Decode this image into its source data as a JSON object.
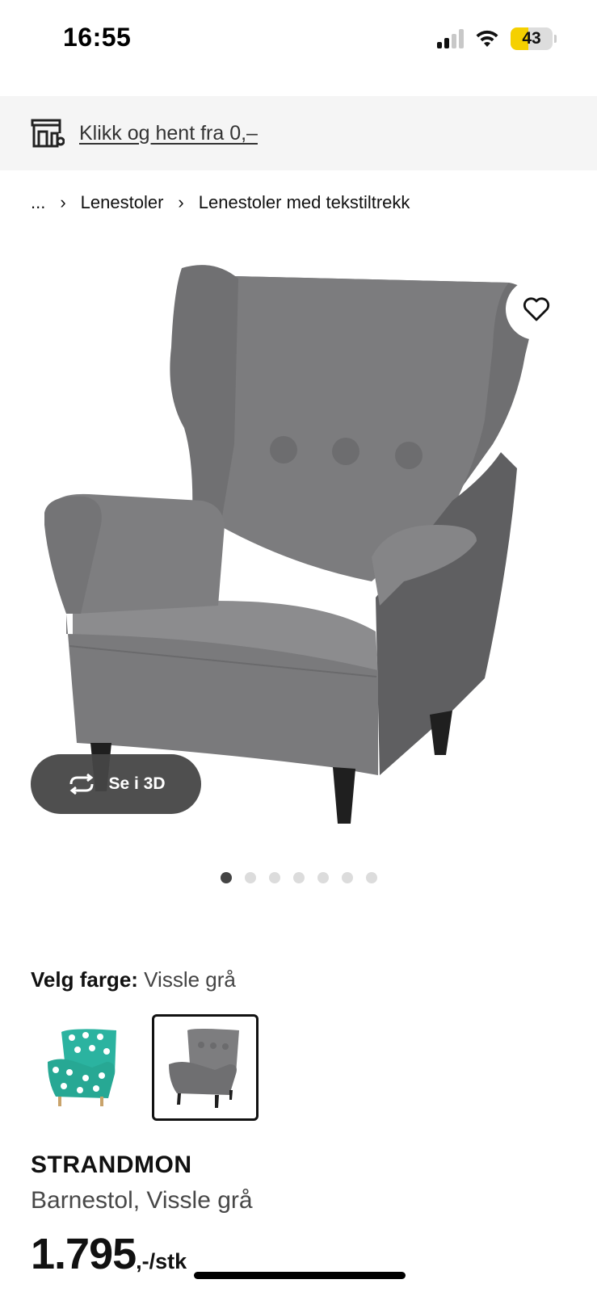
{
  "status_bar": {
    "time": "16:55",
    "battery_level": "43",
    "battery_fraction": 0.43
  },
  "banner": {
    "text": "Klikk og hent fra 0,–",
    "icon": "store-pickup-icon"
  },
  "breadcrumb": {
    "ellipsis": "...",
    "items": [
      "Lenestoler",
      "Lenestoler med tekstiltrekk"
    ]
  },
  "gallery": {
    "view_3d_label": "Se i 3D",
    "image_count": 7,
    "active_index": 0
  },
  "color": {
    "label": "Velg farge:",
    "selected": "Vissle grå",
    "options_count": 2,
    "selected_index": 1
  },
  "product": {
    "name": "STRANDMON",
    "description": "Barnestol, Vissle grå",
    "price": "1.795",
    "price_suffix": ",-/stk"
  },
  "colors": {
    "chair_grey": "#8a8a8c",
    "chair_teal": "#2bb3a0",
    "accent_yellow": "#f5d000"
  }
}
